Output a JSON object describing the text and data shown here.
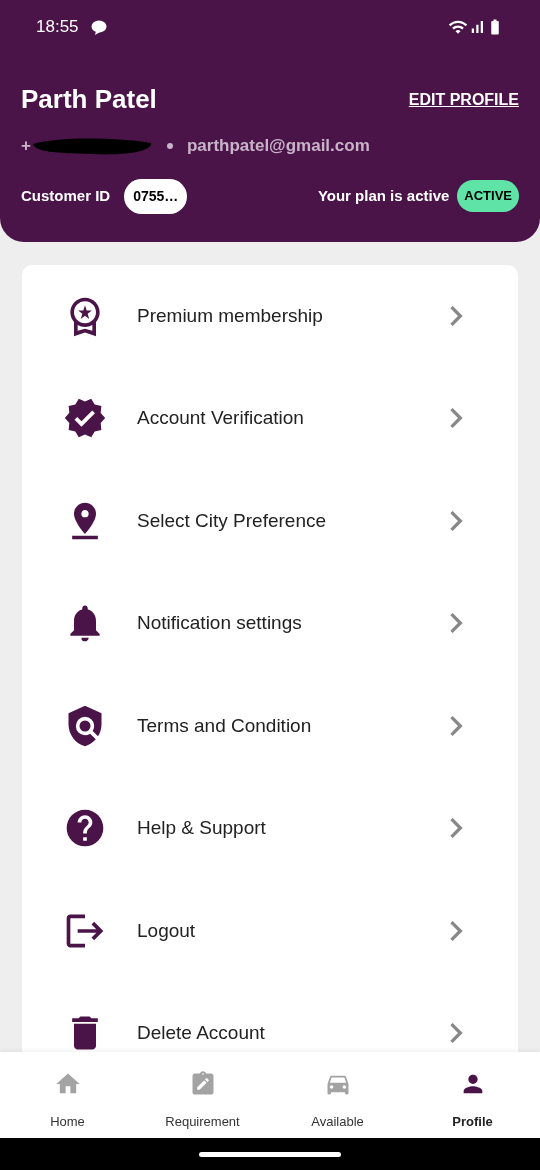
{
  "status_bar": {
    "time": "18:55"
  },
  "profile": {
    "name": "Parth Patel",
    "edit_link": "EDIT PROFILE",
    "phone": "+",
    "email": "parthpatel@gmail.com",
    "customer_id_label": "Customer ID",
    "customer_id": "0755…",
    "plan_text": "Your plan is active",
    "plan_badge": "ACTIVE"
  },
  "menu": [
    {
      "kind": "premium",
      "label": "Premium membership"
    },
    {
      "kind": "verified",
      "label": "Account Verification"
    },
    {
      "kind": "location",
      "label": "Select City Preference"
    },
    {
      "kind": "bell",
      "label": "Notification settings"
    },
    {
      "kind": "shield",
      "label": "Terms and Condition"
    },
    {
      "kind": "help",
      "label": "Help & Support"
    },
    {
      "kind": "logout",
      "label": "Logout"
    },
    {
      "kind": "delete",
      "label": "Delete Account"
    }
  ],
  "bottom_nav": [
    {
      "kind": "home",
      "label": "Home",
      "selected": false
    },
    {
      "kind": "requirement",
      "label": "Requirement",
      "selected": false
    },
    {
      "kind": "car",
      "label": "Available",
      "selected": false
    },
    {
      "kind": "profile",
      "label": "Profile",
      "selected": true
    }
  ]
}
